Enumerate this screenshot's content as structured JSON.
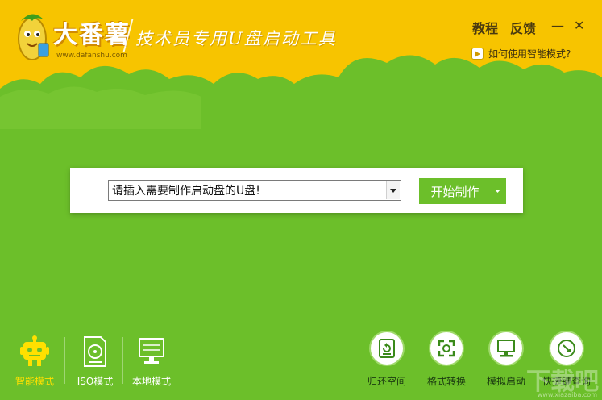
{
  "header": {
    "logo_text": "大番薯",
    "logo_url": "www.dafanshu.com",
    "slogan": "技术员专用U盘启动工具",
    "links": {
      "tutorial": "教程",
      "feedback": "反馈"
    },
    "minimize_glyph": "—",
    "close_glyph": "✕",
    "help_text": "如何使用智能模式?"
  },
  "main": {
    "usb_select_value": "请插入需要制作启动盘的U盘!",
    "start_button": "开始制作"
  },
  "modes": [
    {
      "label": "智能模式",
      "icon": "robot-icon",
      "active": true
    },
    {
      "label": "ISO模式",
      "icon": "iso-disc-icon",
      "active": false
    },
    {
      "label": "本地模式",
      "icon": "monitor-icon",
      "active": false
    }
  ],
  "tools": [
    {
      "label": "归还空间",
      "icon": "disk-restore-icon"
    },
    {
      "label": "格式转换",
      "icon": "format-convert-icon"
    },
    {
      "label": "模拟启动",
      "icon": "computer-boot-icon"
    },
    {
      "label": "快捷键查询",
      "icon": "shortcut-key-icon"
    }
  ],
  "watermark": {
    "text": "下载吧",
    "url": "www.xiazaiba.com"
  },
  "colors": {
    "header_yellow": "#f7c400",
    "body_green": "#6cbf2a",
    "active_label": "#ffe000"
  }
}
